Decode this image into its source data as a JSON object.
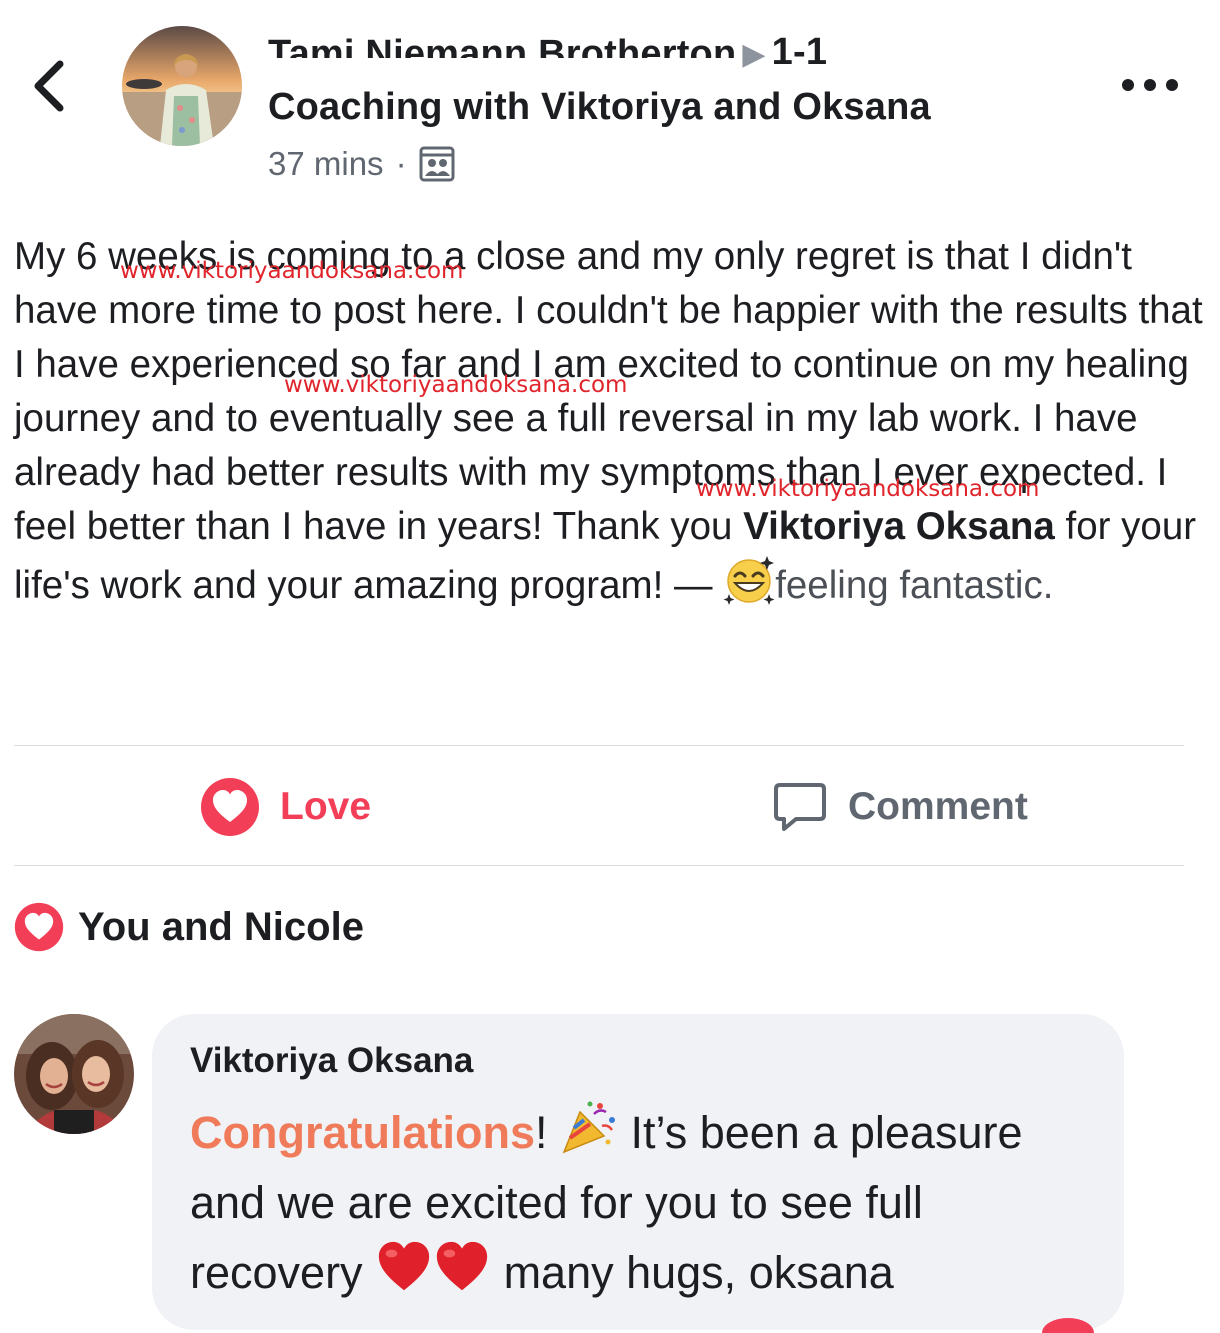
{
  "header": {
    "title_name": "Tami Niemann Brotherton",
    "title_group_part1": "1-1",
    "title_group_part2": "Coaching with Viktoriya and Oksana",
    "time": "37 mins",
    "separator": "·",
    "audience_icon": "group-audience-icon"
  },
  "post": {
    "text_before": "My 6 weeks is coming to a close and my only regret is that I didn't have more time to post here.  I couldn't be happier with the results that I have experienced so far and I am excited to continue on my healing journey and to eventually see a full reversal in my lab work.  I have already had better results with my symptoms than I ever expected.  I feel better than I have in years!  Thank you ",
    "tagged": "Viktoriya Oksana",
    "text_after": " for your life's work and your amazing program! —",
    "feeling": "feeling fantastic.",
    "feeling_icon": "starry-grin-emoji-icon"
  },
  "watermark": "www.viktoriyaandoksana.com",
  "actions": {
    "love": "Love",
    "comment": "Comment"
  },
  "reactions": {
    "text": "You and Nicole",
    "icon": "heart-reaction-icon"
  },
  "comment": {
    "author": "Viktoriya Oksana",
    "highlight": "Congratulations",
    "after_highlight": "!",
    "line1_rest": " It’s been a pleasure and we are excited for you to see full recovery ",
    "line_end": " many hugs, oksana",
    "emojis": [
      "party-popper-icon",
      "red-heart-icon",
      "red-heart-icon"
    ]
  },
  "colors": {
    "love": "#f33e58",
    "watermark": "#e0252c",
    "highlight": "#ef7b5a",
    "bubble": "#f0f2f5",
    "secondary": "#606770"
  }
}
